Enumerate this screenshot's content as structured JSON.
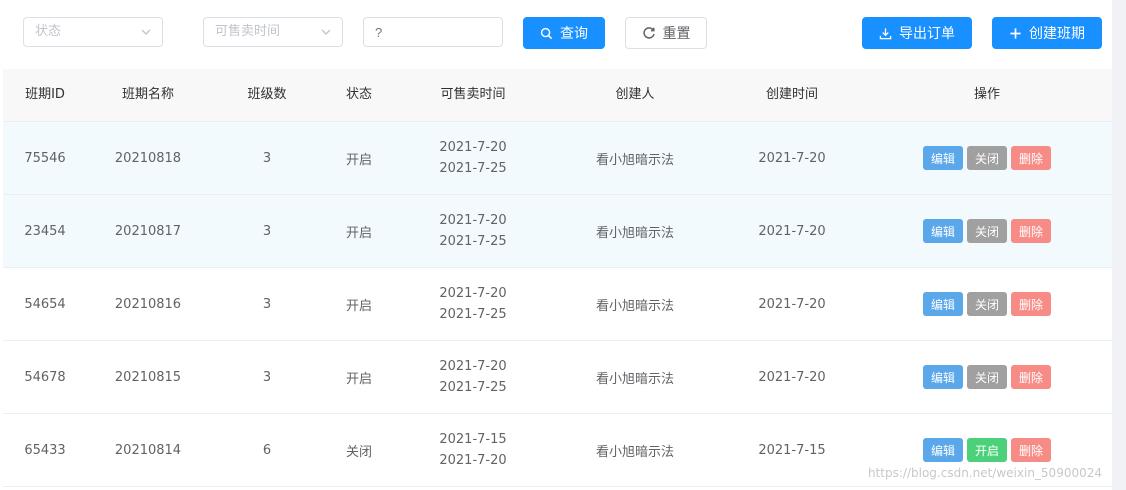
{
  "filters": {
    "status_placeholder": "状态",
    "sale_time_placeholder": "可售卖时间",
    "keyword_placeholder": "?"
  },
  "toolbar": {
    "search_label": "查询",
    "reset_label": "重置",
    "export_label": "导出订单",
    "create_label": "创建班期"
  },
  "table": {
    "headers": [
      "班期ID",
      "班期名称",
      "班级数",
      "状态",
      "可售卖时间",
      "创建人",
      "创建时间",
      "操作"
    ],
    "rows": [
      {
        "id": "75546",
        "name": "20210818",
        "count": "3",
        "status": "开启",
        "sale_start": "2021-7-20",
        "sale_end": "2021-7-25",
        "creator": "看小旭暗示法",
        "created": "2021-7-20",
        "op_edit": "编辑",
        "op_toggle": "关闭",
        "op_delete": "删除"
      },
      {
        "id": "23454",
        "name": "20210817",
        "count": "3",
        "status": "开启",
        "sale_start": "2021-7-20",
        "sale_end": "2021-7-25",
        "creator": "看小旭暗示法",
        "created": "2021-7-20",
        "op_edit": "编辑",
        "op_toggle": "关闭",
        "op_delete": "删除"
      },
      {
        "id": "54654",
        "name": "20210816",
        "count": "3",
        "status": "开启",
        "sale_start": "2021-7-20",
        "sale_end": "2021-7-25",
        "creator": "看小旭暗示法",
        "created": "2021-7-20",
        "op_edit": "编辑",
        "op_toggle": "关闭",
        "op_delete": "删除"
      },
      {
        "id": "54678",
        "name": "20210815",
        "count": "3",
        "status": "开启",
        "sale_start": "2021-7-20",
        "sale_end": "2021-7-25",
        "creator": "看小旭暗示法",
        "created": "2021-7-20",
        "op_edit": "编辑",
        "op_toggle": "关闭",
        "op_delete": "删除"
      },
      {
        "id": "65433",
        "name": "20210814",
        "count": "6",
        "status": "关闭",
        "sale_start": "2021-7-15",
        "sale_end": "2021-7-20",
        "creator": "看小旭暗示法",
        "created": "2021-7-15",
        "op_edit": "编辑",
        "op_toggle": "开启",
        "op_delete": "删除"
      }
    ]
  },
  "colors": {
    "primary": "#1890ff",
    "edit": "#5aa8ea",
    "close": "#a0a0a0",
    "open": "#4cd17a",
    "delete": "#f78c86",
    "row_highlight": "#f3fafe"
  },
  "icons": {
    "search": "search-icon",
    "reset": "refresh-icon",
    "export": "download-icon",
    "create": "plus-icon",
    "dropdown": "chevron-down-icon"
  },
  "watermark": "https://blog.csdn.net/weixin_50900024"
}
